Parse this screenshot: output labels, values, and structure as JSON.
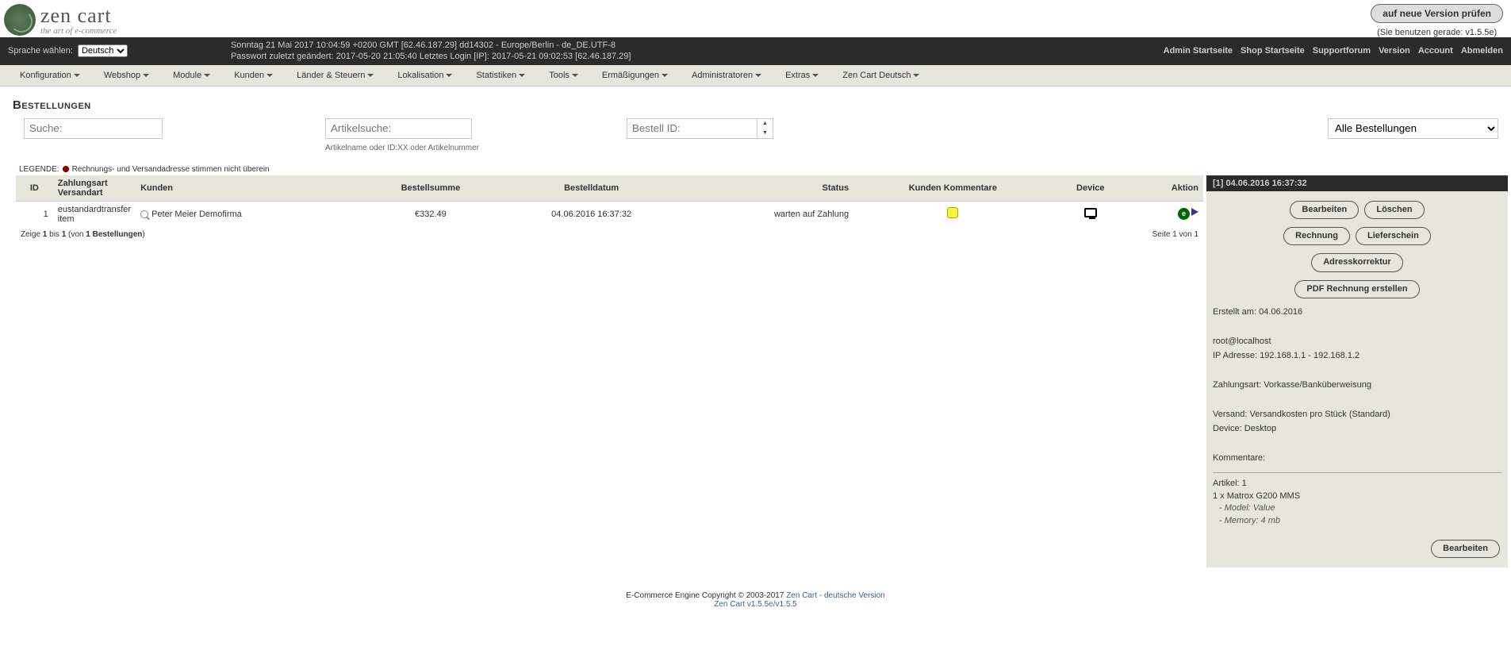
{
  "header": {
    "logo_main": "zen cart",
    "logo_sub": "the art of e-commerce",
    "version_button": "auf neue Version prüfen",
    "version_text": "(Sie benutzen gerade: v1.5.5e)"
  },
  "darkbar": {
    "lang_label": "Sprache wählen:",
    "lang_value": "Deutsch",
    "info_line1": "Sonntag 21 Mai 2017 10:04:59 +0200 GMT [62.46.187.29]  dd14302 - Europe/Berlin - de_DE.UTF-8",
    "info_line2": "Passwort zuletzt geändert: 2017-05-20 21:05:40   Letztes Login [IP]: 2017-05-21 09:02:53 [62.46.187.29]",
    "nav": [
      "Admin Startseite",
      "Shop Startseite",
      "Supportforum",
      "Version",
      "Account",
      "Abmelden"
    ]
  },
  "menu": [
    "Konfiguration",
    "Webshop",
    "Module",
    "Kunden",
    "Länder & Steuern",
    "Lokalisation",
    "Statistiken",
    "Tools",
    "Ermäßigungen",
    "Administratoren",
    "Extras",
    "Zen Cart Deutsch"
  ],
  "page_title": "Bestellungen",
  "filters": {
    "search_ph": "Suche:",
    "article_ph": "Artikelsuche:",
    "article_hint": "Artikelname oder ID:XX oder Artikelnummer",
    "orderid_ph": "Bestell ID:",
    "status_value": "Alle Bestellungen"
  },
  "legend": {
    "label": "LEGENDE:",
    "text": "Rechnungs- und Versandadresse stimmen nicht überein"
  },
  "table": {
    "headers": {
      "id": "ID",
      "payment": "Zahlungsart Versandart",
      "customer": "Kunden",
      "total": "Bestellsumme",
      "date": "Bestelldatum",
      "status": "Status",
      "comments": "Kunden Kommentare",
      "device": "Device",
      "action": "Aktion"
    },
    "row": {
      "id": "1",
      "payment": "eustandardtransfer item",
      "customer": "Peter Meier Demofirma",
      "total": "€332.49",
      "date": "04.06.2016 16:37:32",
      "status": "warten auf Zahlung"
    },
    "pager_left_a": "Zeige ",
    "pager_left_b": "1",
    "pager_left_c": " bis ",
    "pager_left_d": "1",
    "pager_left_e": " (von ",
    "pager_left_f": "1 Bestellungen",
    "pager_left_g": ")",
    "pager_right": "Seite 1 von 1"
  },
  "side": {
    "header": "[1]  04.06.2016 16:37:32",
    "buttons": {
      "edit": "Bearbeiten",
      "delete": "Löschen",
      "invoice": "Rechnung",
      "slip": "Lieferschein",
      "address": "Adresskorrektur",
      "pdf": "PDF Rechnung erstellen"
    },
    "created": "Erstellt am: 04.06.2016",
    "email": "root@localhost",
    "ip": "IP Adresse: 192.168.1.1 - 192.168.1.2",
    "payment": "Zahlungsart: Vorkasse/Banküberweisung",
    "shipping": "Versand: Versandkosten pro Stück (Standard)",
    "device": "Device: Desktop",
    "comments_label": "Kommentare:",
    "articles_label": "Artikel: 1",
    "article_line": "1 x Matrox G200 MMS",
    "model": "- Model: Value",
    "memory": "- Memory: 4 mb",
    "edit_btn": "Bearbeiten"
  },
  "footer": {
    "line1a": "E-Commerce Engine Copyright © 2003-2017 ",
    "link1": "Zen Cart - deutsche Version",
    "line2": "Zen Cart v1.5.5e/v1.5.5"
  }
}
